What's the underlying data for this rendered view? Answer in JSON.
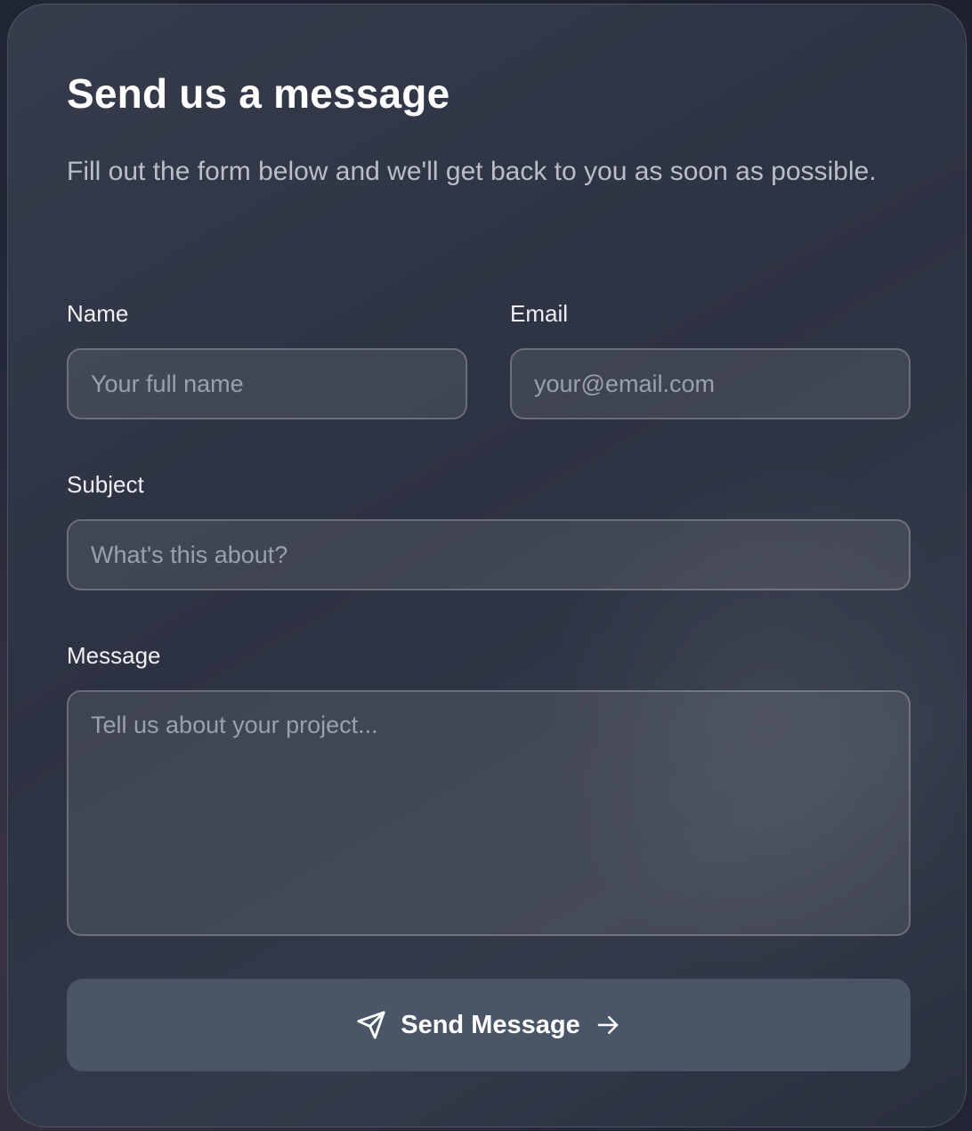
{
  "form": {
    "title": "Send us a message",
    "subtitle": "Fill out the form below and we'll get back to you as soon as possible.",
    "name": {
      "label": "Name",
      "placeholder": "Your full name",
      "value": ""
    },
    "email": {
      "label": "Email",
      "placeholder": "your@email.com",
      "value": ""
    },
    "subject": {
      "label": "Subject",
      "placeholder": "What's this about?",
      "value": ""
    },
    "message": {
      "label": "Message",
      "placeholder": "Tell us about your project...",
      "value": ""
    },
    "submit": {
      "label": "Send Message",
      "leading_icon": "paper-plane-icon",
      "trailing_icon": "arrow-right-icon"
    }
  },
  "colors": {
    "background": "#1e2230",
    "card": "#313646",
    "button": "#4a5568",
    "text": "#ffffff",
    "muted_text": "#b9bec9",
    "placeholder": "#9aa0ad"
  }
}
